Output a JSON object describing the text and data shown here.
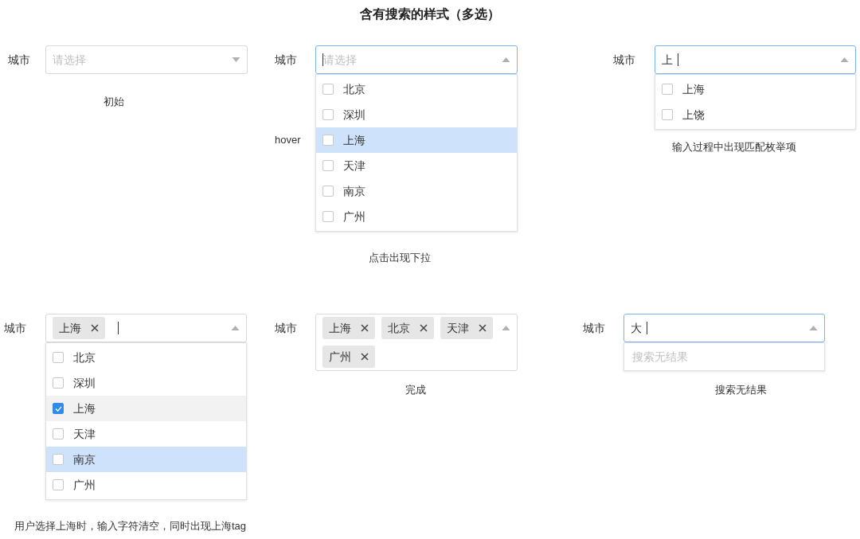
{
  "title": "含有搜索的样式（多选）",
  "demos": [
    {
      "label": "城市",
      "field": {
        "placeholder": "请选择",
        "focused": false,
        "cursor": false,
        "open": false
      },
      "caption": "初始"
    },
    {
      "label": "城市",
      "field": {
        "placeholder": "请选择",
        "focused": true,
        "cursor": true,
        "open": true
      },
      "side_note": "hover",
      "options": [
        {
          "text": "北京",
          "checked": false,
          "hovered": false,
          "selected": false
        },
        {
          "text": "深圳",
          "checked": false,
          "hovered": false,
          "selected": false
        },
        {
          "text": "上海",
          "checked": false,
          "hovered": true,
          "selected": false
        },
        {
          "text": "天津",
          "checked": false,
          "hovered": false,
          "selected": false
        },
        {
          "text": "南京",
          "checked": false,
          "hovered": false,
          "selected": false
        },
        {
          "text": "广州",
          "checked": false,
          "hovered": false,
          "selected": false
        }
      ],
      "caption": "点击出现下拉"
    },
    {
      "label": "城市",
      "field": {
        "value": "上",
        "focused": true,
        "cursor": true,
        "open": true
      },
      "options": [
        {
          "text": "上海",
          "checked": false,
          "hovered": false,
          "selected": false
        },
        {
          "text": "上饶",
          "checked": false,
          "hovered": false,
          "selected": false
        }
      ],
      "caption": "输入过程中出现匹配枚举项"
    },
    {
      "label": "城市",
      "field": {
        "tags": [
          "上海"
        ],
        "focused": false,
        "cursor": true,
        "open": true
      },
      "options": [
        {
          "text": "北京",
          "checked": false,
          "hovered": false,
          "selected": false
        },
        {
          "text": "深圳",
          "checked": false,
          "hovered": false,
          "selected": false
        },
        {
          "text": "上海",
          "checked": true,
          "hovered": false,
          "selected": true
        },
        {
          "text": "天津",
          "checked": false,
          "hovered": false,
          "selected": false
        },
        {
          "text": "南京",
          "checked": false,
          "hovered": true,
          "selected": false
        },
        {
          "text": "广州",
          "checked": false,
          "hovered": false,
          "selected": false
        }
      ],
      "caption": "用户选择上海时，输入字符清空，同时出现上海tag"
    },
    {
      "label": "城市",
      "field": {
        "tags": [
          "上海",
          "北京",
          "天津",
          "广州"
        ],
        "focused": false,
        "cursor": false,
        "open": true
      },
      "caption": "完成"
    },
    {
      "label": "城市",
      "field": {
        "value": "大",
        "focused": true,
        "cursor": true,
        "open": true
      },
      "empty_text": "搜索无结果",
      "caption": "搜索无结果"
    }
  ]
}
